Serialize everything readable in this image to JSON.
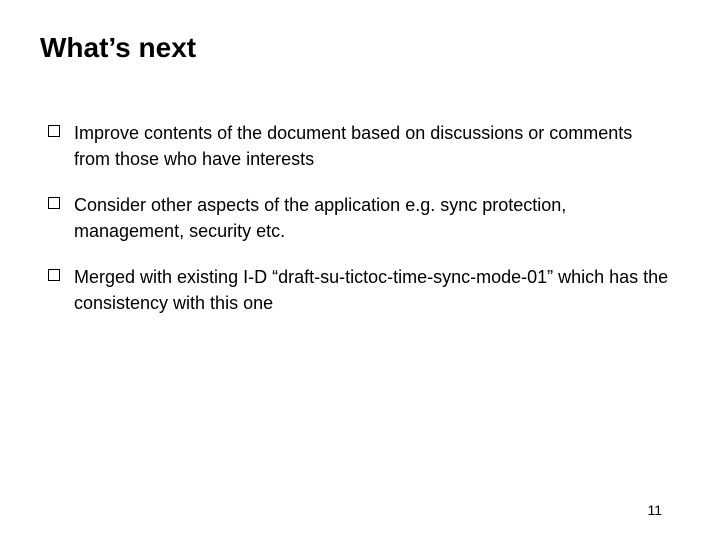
{
  "title": "What’s next",
  "bullets": [
    {
      "text": "Improve contents of the document based on discussions or comments from those who have interests"
    },
    {
      "text": "Consider other aspects of the application e.g. sync protection, management, security etc."
    },
    {
      "text": "Merged with existing I-D “draft-su-tictoc-time-sync-mode-01” which has the consistency with this one"
    }
  ],
  "page_number": "11"
}
